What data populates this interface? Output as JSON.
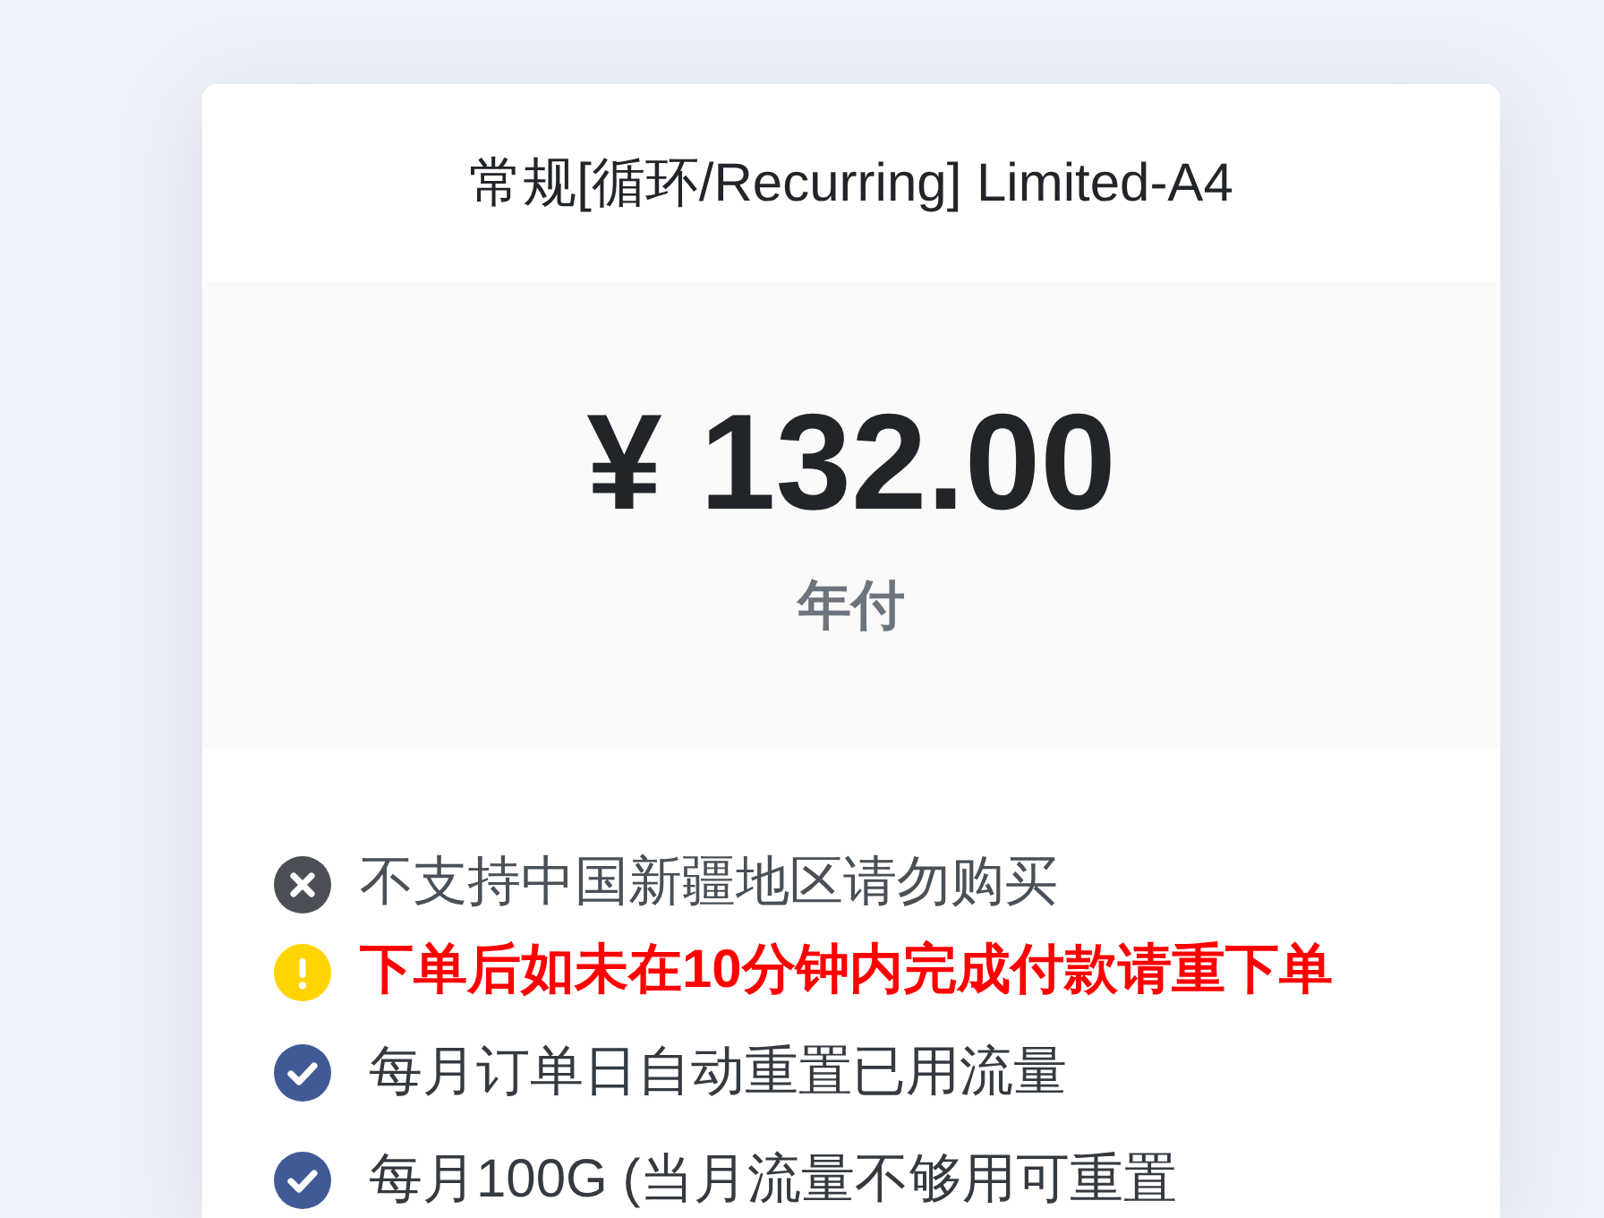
{
  "plan": {
    "title": "常规[循环/Recurring] Limited-A4"
  },
  "price": {
    "amount": "¥ 132.00",
    "period": "年付"
  },
  "notices": [
    {
      "kind": "excluded",
      "text": "不支持中国新疆地区请勿购买"
    },
    {
      "kind": "warning",
      "text": "下单后如未在10分钟内完成付款请重下单"
    }
  ],
  "features": [
    {
      "kind": "included",
      "text": "每月订单日自动重置已用流量"
    },
    {
      "kind": "included",
      "text": "每月100G (当月流量不够用可重置"
    }
  ]
}
